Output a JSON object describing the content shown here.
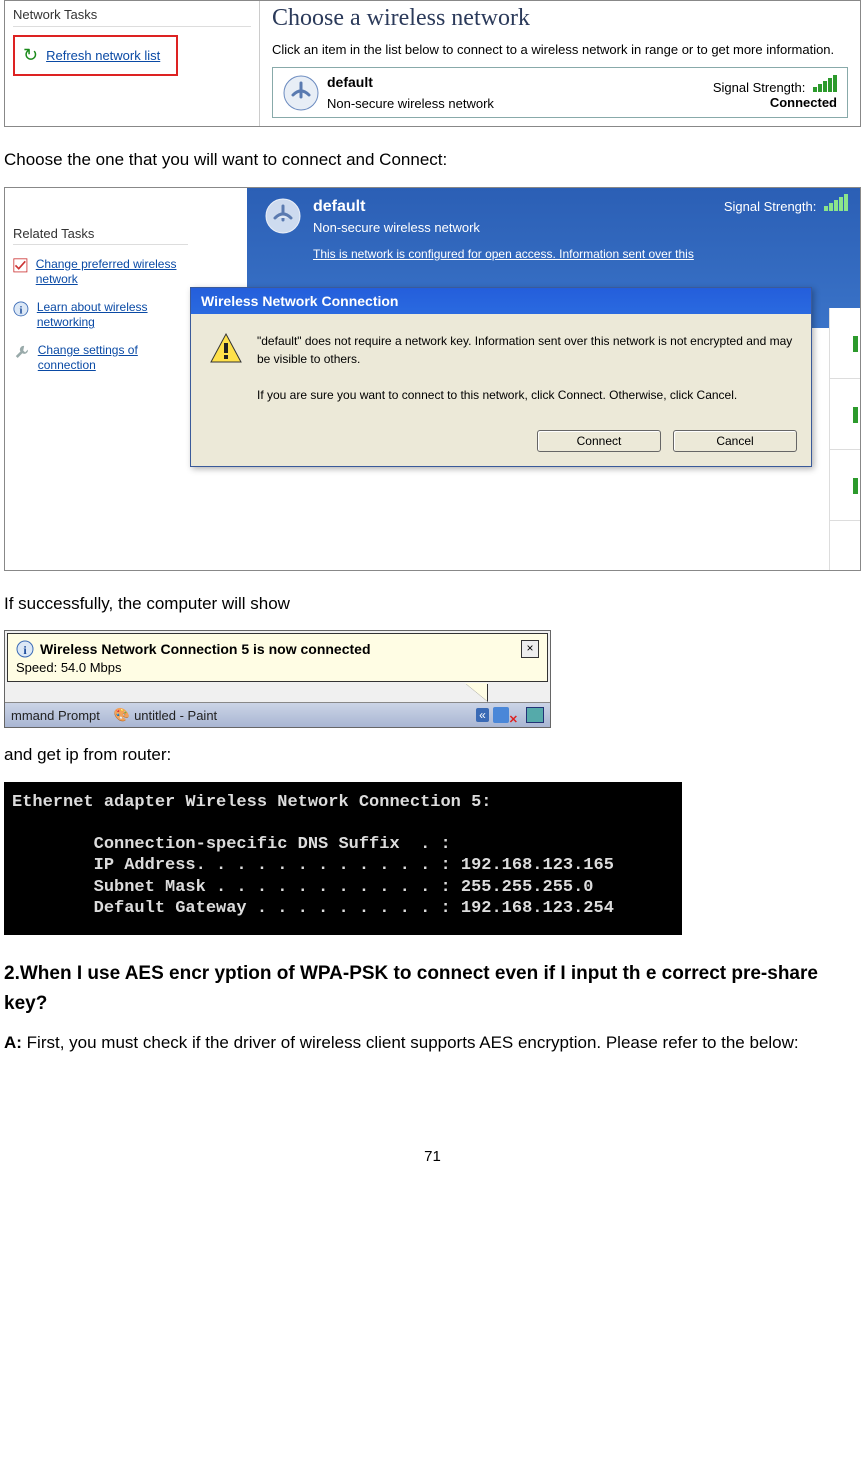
{
  "shot1": {
    "leftHeader": "Network Tasks",
    "refreshLink": "Refresh network list",
    "title": "Choose a wireless network",
    "instruction": "Click an item in the list below to connect to a wireless network in range or to get more information.",
    "net": {
      "name": "default",
      "desc": "Non-secure wireless network",
      "signalLabel": "Signal Strength:",
      "status": "Connected"
    }
  },
  "text1": "Choose the one that you will want to connect and Connect:",
  "shot2": {
    "relatedHeader": "Related Tasks",
    "tasks": [
      "Change preferred wireless network",
      "Learn about wireless networking",
      "Change settings of connection"
    ],
    "sel": {
      "name": "default",
      "desc": "Non-secure wireless network",
      "note": "This is network is configured for open access. Information sent over this",
      "signalLabel": "Signal Strength:"
    },
    "dialog": {
      "title": "Wireless Network Connection",
      "p1": "\"default\" does not require a network key. Information sent over this network is not encrypted and may be visible to others.",
      "p2": "If you are sure you want to connect to this network, click Connect. Otherwise, click Cancel.",
      "connect": "Connect",
      "cancel": "Cancel"
    }
  },
  "text2": "If successfully, the computer will show",
  "toast": {
    "title": "Wireless Network Connection 5 is now connected",
    "speed": "Speed: 54.0 Mbps",
    "partA": "mmand Prompt",
    "partB": "untitled - Paint"
  },
  "text3": "and get ip from router:",
  "term": {
    "l1": "Ethernet adapter Wireless Network Connection 5:",
    "l2": "        Connection-specific DNS Suffix  . :",
    "l3": "        IP Address. . . . . . . . . . . . : 192.168.123.165",
    "l4": "        Subnet Mask . . . . . . . . . . . : 255.255.255.0",
    "l5": "        Default Gateway . . . . . . . . . : 192.168.123.254"
  },
  "question": "2.When I use AES encr yption of WPA-PSK to connect even if I input th  e correct pre-share key?",
  "answerLead": "A:",
  "answerBody": " First, you must check if the driver of wireless client supports AES encryption. Please refer to the below:",
  "pageNumber": "71"
}
